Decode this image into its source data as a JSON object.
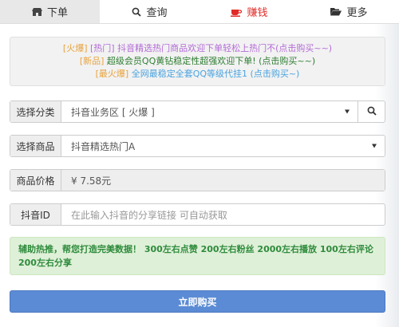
{
  "tabs": [
    {
      "label": "下单",
      "icon": "shop-icon"
    },
    {
      "label": "查询",
      "icon": "search-icon"
    },
    {
      "label": "赚钱",
      "icon": "coffee-cup-icon"
    },
    {
      "label": "更多",
      "icon": "folder-open-icon"
    }
  ],
  "notice": {
    "line1_tag": "[火爆]",
    "line1_text": " [热门] 抖音精选热门商品欢迎下单轻松上热门不(点击购买~~)",
    "line2_tag": "[新品]",
    "line2_text": " 超级会员QQ黄钻稳定性超强欢迎下单! (点击购买~~)",
    "line3_tag": "[最火爆]",
    "line3_text": " 全网最稳定全套QQ等级代挂1 (点击购买~)"
  },
  "form": {
    "category_label": "选择分类",
    "category_value": "抖音业务区 [ 火爆 ]",
    "product_label": "选择商品",
    "product_value": "抖音精选热门A",
    "price_label": "商品价格",
    "price_value": "¥ 7.58元",
    "douyin_label": "抖音ID",
    "douyin_placeholder": "在此输入抖音的分享链接 可自动获取"
  },
  "tips_text": "辅助热推，帮您打造完美数据！ 300左右点赞 200左右粉丝 2000左右播放 100左右评论 200左右分享",
  "buy_label": "立即购买",
  "colors": {
    "accent": "#5b8bd4",
    "earn_red": "#e02b27",
    "success_bg": "#dff0d8",
    "success_text": "#2e8b3c"
  }
}
